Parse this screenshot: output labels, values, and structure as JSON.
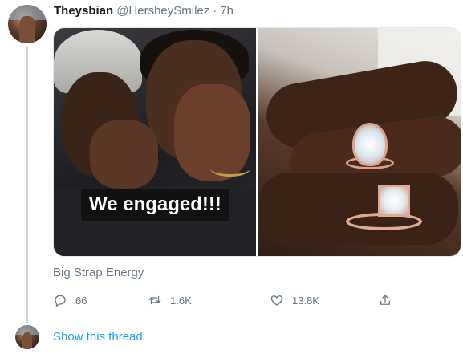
{
  "tweet": {
    "display_name": "Theysbian",
    "handle": "@HersheySmilez",
    "separator": "·",
    "time": "7h",
    "text": "Big Strap Energy",
    "media_caption": "We engaged!!!"
  },
  "actions": {
    "replies": "66",
    "retweets": "1.6K",
    "likes": "13.8K"
  },
  "thread": {
    "show_label": "Show this thread"
  },
  "icons": {
    "reply": "reply-icon",
    "retweet": "retweet-icon",
    "like": "heart-icon",
    "share": "share-icon"
  },
  "colors": {
    "accent": "#1da1f2",
    "muted": "#657786",
    "text": "#14171a",
    "line": "#ccd6dd"
  }
}
